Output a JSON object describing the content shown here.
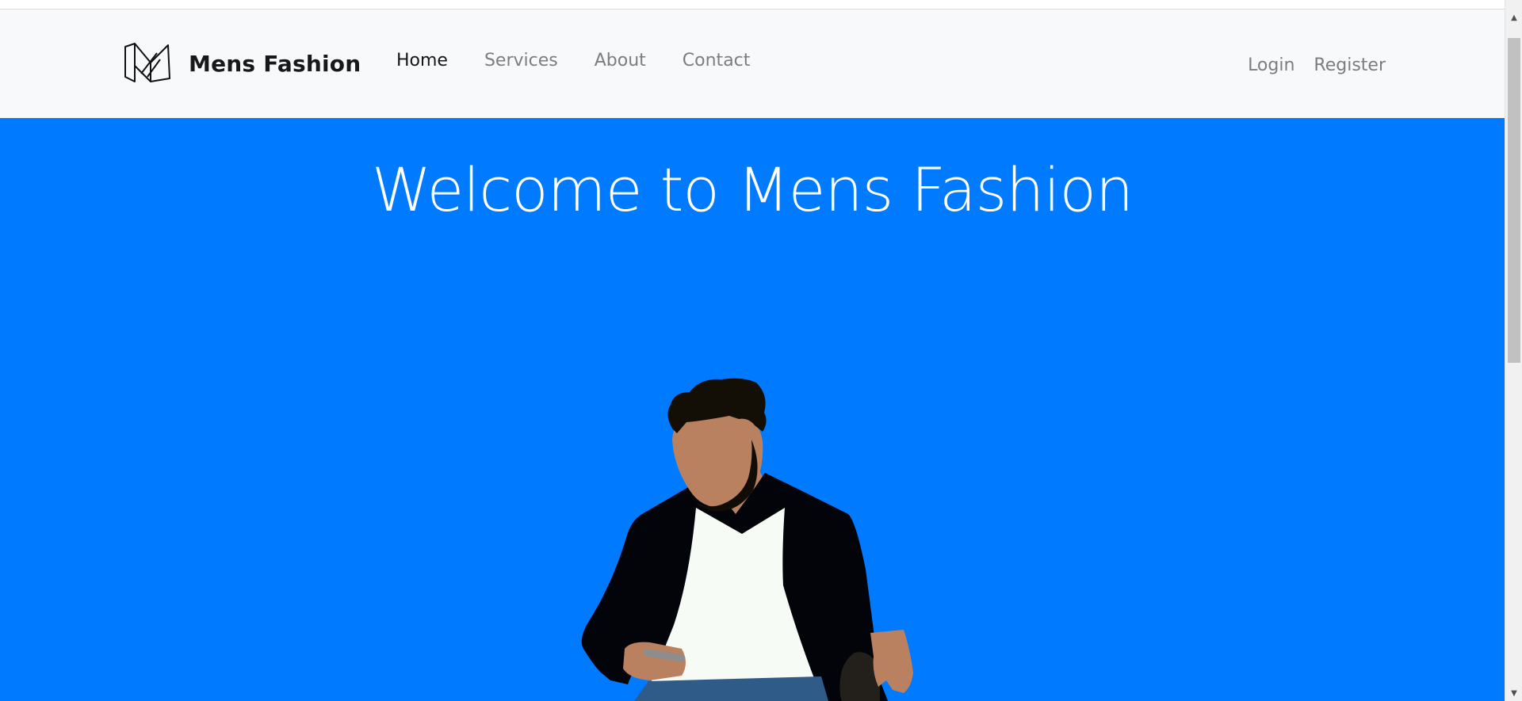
{
  "navbar": {
    "brand_name": "Mens Fashion",
    "brand_icon": "mf-logo-icon",
    "links": [
      {
        "label": "Home",
        "active": true
      },
      {
        "label": "Services",
        "active": false
      },
      {
        "label": "About",
        "active": false
      },
      {
        "label": "Contact",
        "active": false
      }
    ],
    "auth": {
      "login_label": "Login",
      "register_label": "Register"
    }
  },
  "hero": {
    "title": "Welcome to Mens Fashion",
    "background_color": "#007bff",
    "illustration": "man-in-blazer-illustration"
  },
  "scrollbar": {
    "up_icon": "scroll-up-arrow-icon",
    "down_icon": "scroll-down-arrow-icon"
  }
}
